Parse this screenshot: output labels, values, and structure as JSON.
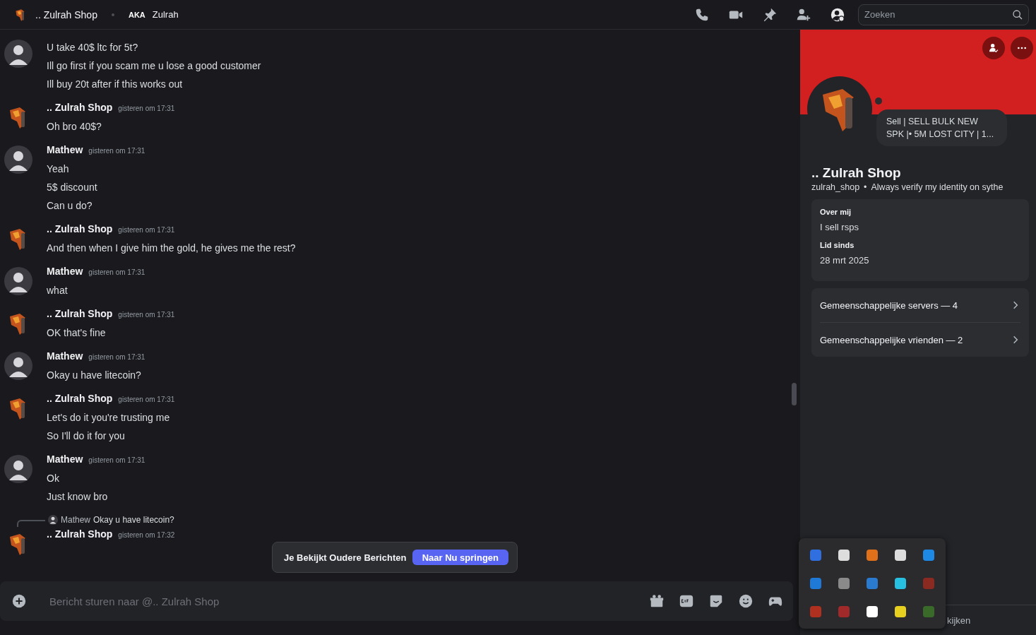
{
  "header": {
    "title": ".. Zulrah Shop",
    "aka_label": "AKA",
    "aka_name": "Zulrah",
    "search": {
      "placeholder": "Zoeken"
    }
  },
  "messages": [
    {
      "kind": "continuation",
      "avatar": {
        "kind": "person"
      },
      "lines": [
        "U take 40$ ltc for 5t?",
        "Ill go first if you scam me u lose a good customer",
        "Ill buy 20t after if this works out"
      ]
    },
    {
      "kind": "group",
      "avatar": {
        "kind": "dragon"
      },
      "author": ".. Zulrah Shop",
      "time": "gisteren om 17:31",
      "lines": [
        "Oh bro 40$?"
      ]
    },
    {
      "kind": "group",
      "avatar": {
        "kind": "person"
      },
      "author": "Mathew",
      "time": "gisteren om 17:31",
      "lines": [
        "Yeah",
        "5$ discount",
        "Can u do?"
      ]
    },
    {
      "kind": "group",
      "avatar": {
        "kind": "dragon"
      },
      "author": ".. Zulrah Shop",
      "time": "gisteren om 17:31",
      "lines": [
        "And then when I give him the gold, he gives me the rest?"
      ]
    },
    {
      "kind": "group",
      "avatar": {
        "kind": "person"
      },
      "author": "Mathew",
      "time": "gisteren om 17:31",
      "lines": [
        "what"
      ]
    },
    {
      "kind": "group",
      "avatar": {
        "kind": "dragon"
      },
      "author": ".. Zulrah Shop",
      "time": "gisteren om 17:31",
      "lines": [
        "OK that's fine"
      ]
    },
    {
      "kind": "group",
      "avatar": {
        "kind": "person"
      },
      "author": "Mathew",
      "time": "gisteren om 17:31",
      "lines": [
        "Okay u have litecoin?"
      ]
    },
    {
      "kind": "group",
      "avatar": {
        "kind": "dragon"
      },
      "author": ".. Zulrah Shop",
      "time": "gisteren om 17:31",
      "lines": [
        "Let's do it you're trusting me",
        "So I'll do it for you"
      ]
    },
    {
      "kind": "group",
      "avatar": {
        "kind": "person"
      },
      "author": "Mathew",
      "time": "gisteren om 17:31",
      "lines": [
        "Ok",
        "Just know bro"
      ]
    },
    {
      "kind": "reply",
      "avatar": {
        "kind": "dragon"
      },
      "author": ".. Zulrah Shop",
      "time": "gisteren om 17:32",
      "reply": {
        "author": "Mathew",
        "text": "Okay u have litecoin?"
      }
    }
  ],
  "jump_bar": {
    "text": "Je Bekijkt Oudere Berichten",
    "button": "Naar Nu springen"
  },
  "composer": {
    "placeholder": "Bericht sturen naar @.. Zulrah Shop"
  },
  "profile": {
    "status_text": "Sell | SELL BULK NEW SPK |• 5M LOST CITY | 1...",
    "name": ".. Zulrah Shop",
    "username": "zulrah_shop",
    "separator": "•",
    "tagline": "Always verify my identity on sythe",
    "sections": [
      {
        "title": "Over mij",
        "text": "I sell rsps"
      },
      {
        "title": "Lid sinds",
        "text": "28 mrt 2025"
      }
    ],
    "links": [
      "Gemeenschappelijke servers — 4",
      "Gemeenschappelijke vrienden — 2"
    ],
    "footer_text": "kijken"
  }
}
